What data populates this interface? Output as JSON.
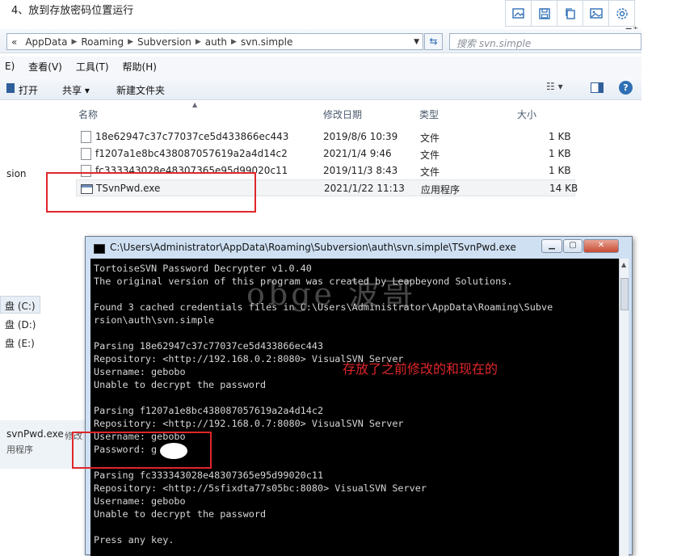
{
  "doc": {
    "step_title": "4、放到存放密码位置运行"
  },
  "toolbar_icons": [
    "image-edit-icon",
    "save-icon",
    "copy-icon",
    "picture-icon",
    "settings-icon"
  ],
  "explorer": {
    "breadcrumb": [
      "«",
      "AppData",
      "Roaming",
      "Subversion",
      "auth",
      "svn.simple"
    ],
    "search_placeholder": "搜索 svn.simple",
    "menu": [
      "E)",
      "查看(V)",
      "工具(T)",
      "帮助(H)"
    ],
    "commands": {
      "open": "打开",
      "share": "共享 ▾",
      "new_folder": "新建文件夹"
    },
    "columns": {
      "name": "名称",
      "date": "修改日期",
      "type": "类型",
      "size": "大小"
    },
    "files": [
      {
        "name": "18e62947c37c77037ce5d433866ec443",
        "date": "2019/8/6 10:39",
        "type": "文件",
        "size": "1 KB"
      },
      {
        "name": "f1207a1e8bc438087057619a2a4d14c2",
        "date": "2021/1/4 9:46",
        "type": "文件",
        "size": "1 KB"
      },
      {
        "name": "fc333343028e48307365e95d99020c11",
        "date": "2019/11/3 8:43",
        "type": "文件",
        "size": "1 KB"
      },
      {
        "name": "TSvnPwd.exe",
        "date": "2021/1/22 11:13",
        "type": "应用程序",
        "size": "14 KB"
      }
    ],
    "nav": {
      "partial": "sion",
      "drive_c": "盘 (C:)",
      "drive_d": "盘 (D:)",
      "drive_e": "盘 (E:)"
    },
    "details": {
      "name": "svnPwd.exe",
      "modified": "修改",
      "type": "用程序"
    }
  },
  "console": {
    "title": "C:\\Users\\Administrator\\AppData\\Roaming\\Subversion\\auth\\svn.simple\\TSvnPwd.exe",
    "output": "TortoiseSVN Password Decrypter v1.0.40\nThe original version of this program was created by Leapbeyond Solutions.\n\nFound 3 cached credentials files in C:\\Users\\Administrator\\AppData\\Roaming\\Subve\nrsion\\auth\\svn.simple\n\nParsing 18e62947c37c77037ce5d433866ec443\nRepository: <http://192.168.0.2:8080> VisualSVN Server\nUsername: gebobo\nUnable to decrypt the password\n\nParsing f1207a1e8bc438087057619a2a4d14c2\nRepository: <http://192.168.0.7:8080> VisualSVN Server\nUsername: gebobo\nPassword: g    o\n\nParsing fc333343028e48307365e95d99020c11\nRepository: <http://5sfixdta77s05bc:8080> VisualSVN Server\nUsername: gebobo\nUnable to decrypt the password\n\nPress any key."
  },
  "annotation": "存放了之前修改的和现在的",
  "watermark": "obge 波哥"
}
